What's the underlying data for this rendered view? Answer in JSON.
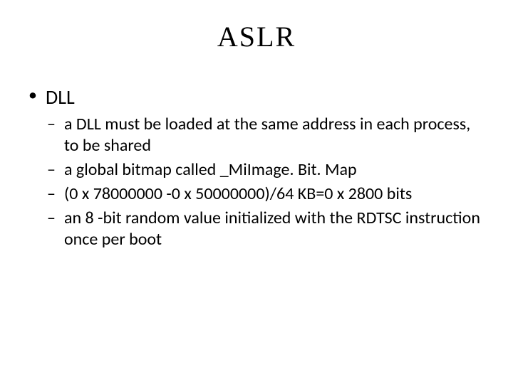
{
  "title": "ASLR",
  "bullets": [
    {
      "label": "DLL",
      "sub": [
        "a DLL must be loaded at the same address in each process, to be shared",
        "a global bitmap called _MiImage. Bit. Map",
        "(0 x 78000000 -0 x 50000000)/64 KB=0 x 2800 bits",
        "an 8 -bit random value initialized with the RDTSC instruction once per boot"
      ]
    }
  ]
}
